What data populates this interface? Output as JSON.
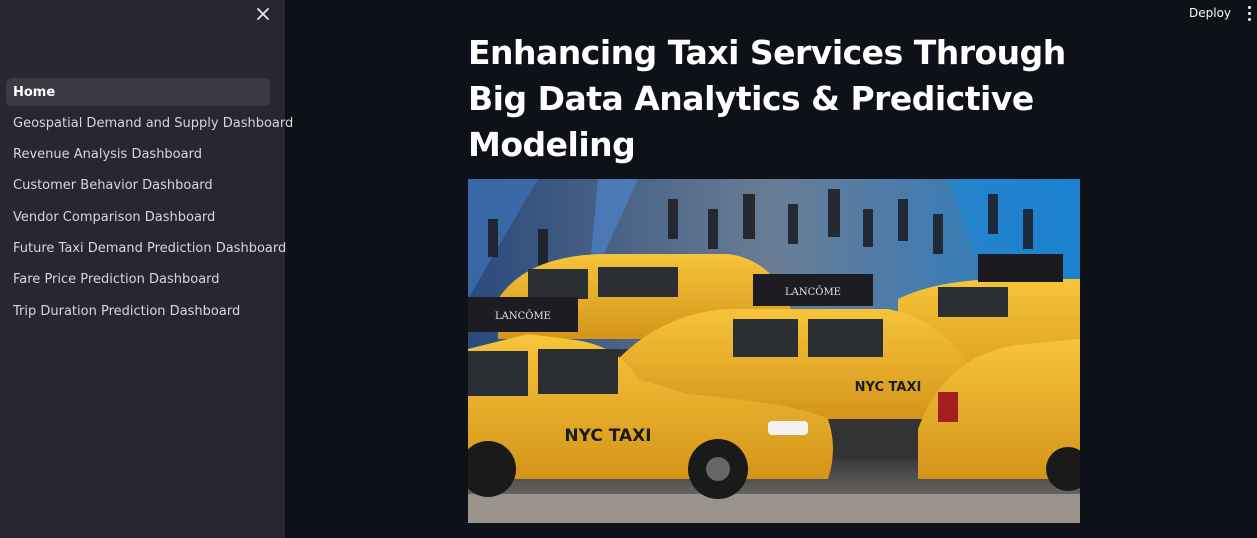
{
  "sidebar": {
    "close_icon": "close-icon",
    "items": [
      {
        "label": "Home",
        "active": true
      },
      {
        "label": "Geospatial Demand and Supply Dashboard",
        "active": false
      },
      {
        "label": "Revenue Analysis Dashboard",
        "active": false
      },
      {
        "label": "Customer Behavior Dashboard",
        "active": false
      },
      {
        "label": "Vendor Comparison Dashboard",
        "active": false
      },
      {
        "label": "Future Taxi Demand Prediction Dashboard",
        "active": false
      },
      {
        "label": "Fare Price Prediction Dashboard",
        "active": false
      },
      {
        "label": "Trip Duration Prediction Dashboard",
        "active": false
      }
    ]
  },
  "header": {
    "deploy_label": "Deploy",
    "menu_icon": "more-vertical-icon"
  },
  "main": {
    "title": "Enhancing Taxi Services Through Big Data Analytics & Predictive Modeling",
    "hero_image": {
      "description_icon": "taxi-photo",
      "sign_text": "LANCÔME",
      "taxi_text": "NYC TAXI"
    }
  },
  "colors": {
    "background": "#0e1117",
    "sidebar": "#262730",
    "active_item": "#3a3b45",
    "taxi_yellow": "#f0b323"
  }
}
